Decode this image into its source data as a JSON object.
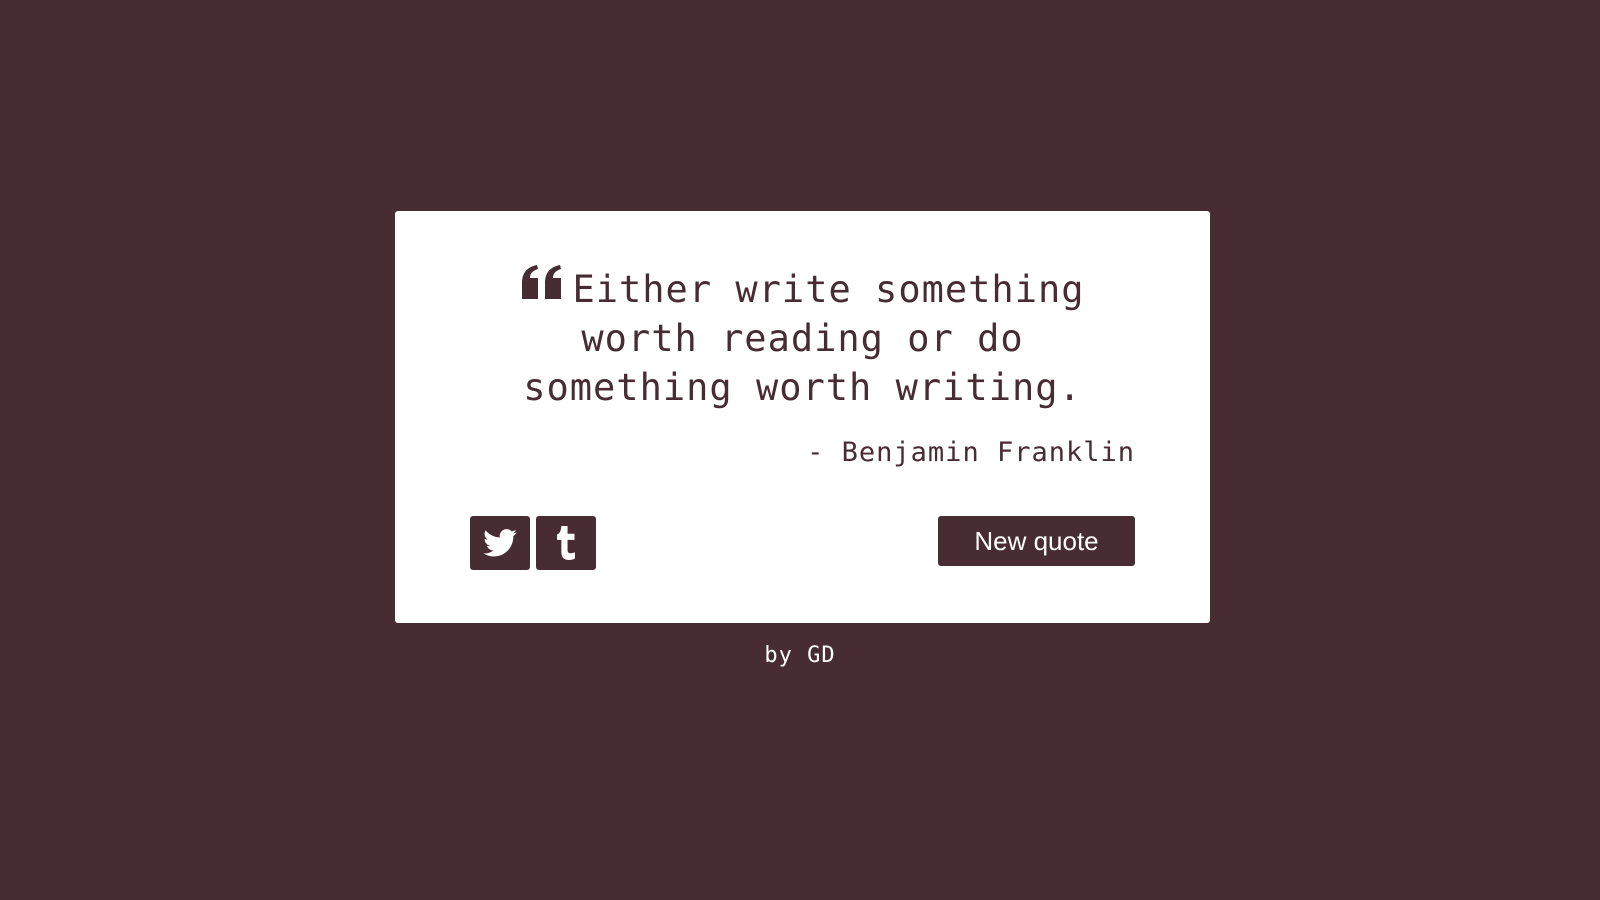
{
  "colors": {
    "background": "#472d33",
    "card": "#ffffff",
    "accent": "#472d33"
  },
  "quote": {
    "text": "Either write something worth reading or do something worth writing.",
    "author": "- Benjamin Franklin",
    "icon": "quote-left-icon"
  },
  "actions": {
    "twitter_icon": "twitter-icon",
    "tumblr_icon": "tumblr-icon",
    "new_quote_label": "New quote"
  },
  "footer": {
    "credit": "by GD"
  }
}
